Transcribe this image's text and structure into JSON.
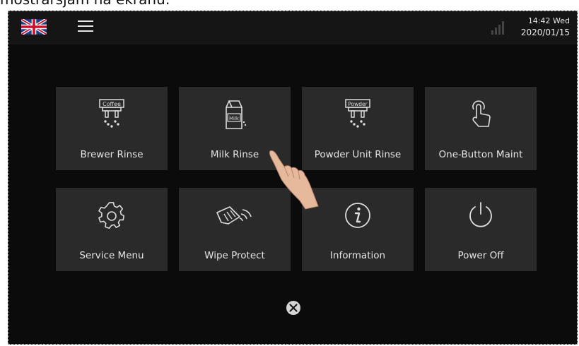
{
  "caption": "mostrarsjam na ekranu:",
  "status": {
    "time": "14:42 Wed",
    "date": "2020/01/15"
  },
  "icons": {
    "language": "uk-flag-icon",
    "menu": "hamburger-menu-icon",
    "signal": "signal-strength-icon",
    "close": "close-circle-icon"
  },
  "tiles": [
    {
      "label": "Brewer Rinse",
      "icon": "coffee-brewer-icon",
      "icon_text": "Coffee"
    },
    {
      "label": "Milk Rinse",
      "icon": "milk-carton-icon",
      "icon_text": "Milk"
    },
    {
      "label": "Powder Unit Rinse",
      "icon": "powder-unit-icon",
      "icon_text": "Powder"
    },
    {
      "label": "One-Button Maint",
      "icon": "touch-finger-icon"
    },
    {
      "label": "Service Menu",
      "icon": "gear-icon"
    },
    {
      "label": "Wipe Protect",
      "icon": "wipe-hand-icon"
    },
    {
      "label": "Information",
      "icon": "info-icon"
    },
    {
      "label": "Power Off",
      "icon": "power-icon"
    }
  ],
  "colors": {
    "screen_bg": "#0b0b0b",
    "topbar_bg": "#151515",
    "tile_bg": "#2a2a2a",
    "text": "#e4e4e4"
  }
}
